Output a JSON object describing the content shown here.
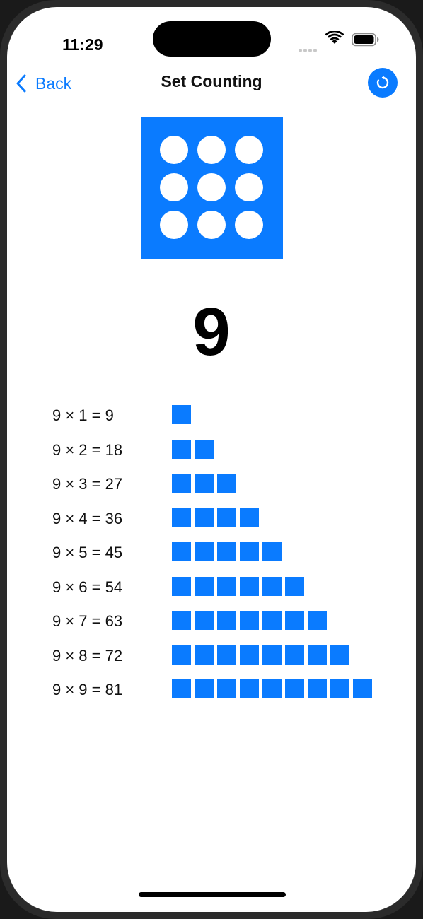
{
  "status_bar": {
    "time": "11:29",
    "icons": [
      "signal-dots-icon",
      "wifi-icon",
      "battery-icon"
    ]
  },
  "nav": {
    "back_label": "Back",
    "title": "Set Counting",
    "refresh_icon": "refresh-icon"
  },
  "colors": {
    "accent": "#0A7BFF",
    "text": "#000000",
    "background": "#FFFFFF"
  },
  "dot_card": {
    "dot_count": 9,
    "rows": 3,
    "columns": 3
  },
  "number": "9",
  "table": [
    {
      "equation": "9 × 1 = 9",
      "blocks": 1
    },
    {
      "equation": "9 × 2 = 18",
      "blocks": 2
    },
    {
      "equation": "9 × 3 = 27",
      "blocks": 3
    },
    {
      "equation": "9 × 4 = 36",
      "blocks": 4
    },
    {
      "equation": "9 × 5 = 45",
      "blocks": 5
    },
    {
      "equation": "9 × 6 = 54",
      "blocks": 6
    },
    {
      "equation": "9 × 7 = 63",
      "blocks": 7
    },
    {
      "equation": "9 × 8 = 72",
      "blocks": 8
    },
    {
      "equation": "9 × 9 = 81",
      "blocks": 9
    }
  ]
}
